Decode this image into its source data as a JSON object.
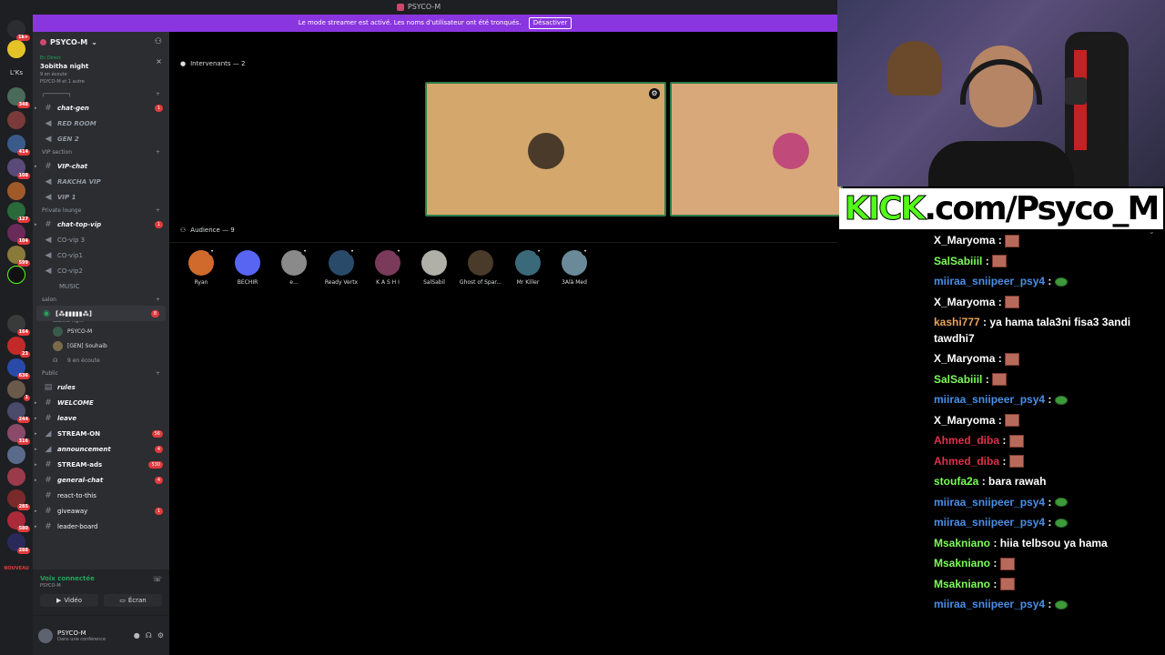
{
  "window": {
    "title": "PSYCO-M"
  },
  "banner": {
    "text": "Le mode streamer est activé. Les noms d'utilisateur ont été tronqués.",
    "button": "Désactiver"
  },
  "rail": {
    "label_lks": "L'Ks",
    "badges": [
      "1k+",
      "348",
      "414",
      "108",
      "127",
      "104",
      "599",
      "164",
      "23",
      "636",
      "1",
      "244",
      "316",
      "285",
      "580",
      "288",
      "NOUVEAU"
    ]
  },
  "server": {
    "name": "PSYCO-M",
    "live_tag": "En Direct",
    "live_title": "3obitha night",
    "live_meta": "9 en écoute",
    "live_meta2": "PSYCO-M et 1 autre"
  },
  "categories": {
    "vip": "VIP section",
    "private": "Private lounge",
    "salon": "salon",
    "public": "Public"
  },
  "channels": {
    "chat_gen": "chat-gen",
    "chat_gen_badge": "1",
    "red_room": "RED ROOM",
    "gen2": "GEN 2",
    "vip_chat": "VIP-chat",
    "rakcha_vip": "RAKCHA VIP",
    "vip1": "VIP 1",
    "chat_top_vip": "chat-top-vip",
    "chat_top_vip_badge": "1",
    "co_vip3": "CO-vip 3",
    "co_vip1": "CO-vip1",
    "co_vip2": "CO-vip2",
    "music": "MUSIC",
    "stage_sub": "3obitha night",
    "stage_badge": "8",
    "stage_user1": "PSYCO-M",
    "stage_user2": "[GEN] Souhaib",
    "stage_listening": "9 en écoute",
    "rules": "rules",
    "welcome": "WELCOME",
    "leave": "leave",
    "stream_on": "STREAM-ON",
    "stream_on_badge": "56",
    "announcement": "announcement",
    "announcement_badge": "4",
    "stream_ads": "STREAM-ads",
    "stream_ads_badge": "530",
    "general_chat": "general-chat",
    "general_chat_badge": "4",
    "react": "react-to-this",
    "giveaway": "giveaway",
    "giveaway_badge": "1",
    "leaderboard": "leader-board"
  },
  "voice": {
    "connected": "Voix connectée",
    "sub": "PSYCO-M",
    "video": "Vidéo",
    "screen": "Écran"
  },
  "user": {
    "name": "PSYCO-M",
    "status": "Dans une conférence"
  },
  "stage": {
    "speakers_label": "Intervenants — 2",
    "audience_label": "Audience — 9",
    "audience": [
      {
        "name": "Ryan",
        "color": "#d06a2c"
      },
      {
        "name": "BECHIR",
        "color": "#5865f2"
      },
      {
        "name": "e...",
        "color": "#8a8a8a"
      },
      {
        "name": "Ready Vertx",
        "color": "#2a4a6a"
      },
      {
        "name": "K A S H I",
        "color": "#7a3a5a"
      },
      {
        "name": "SalSabil",
        "color": "#b0b0a8"
      },
      {
        "name": "Ghost of Spar...",
        "color": "#4a3a2a"
      },
      {
        "name": "Mr Killer",
        "color": "#3a6a7a"
      },
      {
        "name": "3Alà Med",
        "color": "#6a8a9a"
      }
    ]
  },
  "overlay": {
    "kick_prefix": "KICK",
    "kick_rest": ".com/Psyco_M"
  },
  "chat": [
    {
      "user": "X_Maryoma",
      "color": "#ffffff",
      "text": "",
      "emote": "em"
    },
    {
      "user": "SalSabiiil",
      "color": "#7cfc5a",
      "text": "",
      "emote": "em"
    },
    {
      "user": "miiraa_sniipeer_psy4",
      "color": "#4a8fe8",
      "text": "",
      "emote": "pepe"
    },
    {
      "user": "X_Maryoma",
      "color": "#ffffff",
      "text": "",
      "emote": "em"
    },
    {
      "user": "kashi777",
      "color": "#e8a45a",
      "text": "ya hama tala3ni fisa3 3andi tawdhi7",
      "emote": ""
    },
    {
      "user": "X_Maryoma",
      "color": "#ffffff",
      "text": "",
      "emote": "em"
    },
    {
      "user": "SalSabiiil",
      "color": "#7cfc5a",
      "text": "",
      "emote": "em"
    },
    {
      "user": "miiraa_sniipeer_psy4",
      "color": "#4a8fe8",
      "text": "",
      "emote": "pepe"
    },
    {
      "user": "X_Maryoma",
      "color": "#ffffff",
      "text": "",
      "emote": "em"
    },
    {
      "user": "Ahmed_diba",
      "color": "#e0304a",
      "text": "",
      "emote": "em"
    },
    {
      "user": "Ahmed_diba",
      "color": "#e0304a",
      "text": "",
      "emote": "em"
    },
    {
      "user": "stoufa2a",
      "color": "#7cfc5a",
      "text": "bara rawah",
      "emote": ""
    },
    {
      "user": "miiraa_sniipeer_psy4",
      "color": "#4a8fe8",
      "text": "",
      "emote": "pepe"
    },
    {
      "user": "miiraa_sniipeer_psy4",
      "color": "#4a8fe8",
      "text": "",
      "emote": "pepe"
    },
    {
      "user": "Msakniano",
      "color": "#7cfc5a",
      "text": "hiia telbsou ya hama",
      "emote": ""
    },
    {
      "user": "Msakniano",
      "color": "#7cfc5a",
      "text": "",
      "emote": "em"
    },
    {
      "user": "Msakniano",
      "color": "#7cfc5a",
      "text": "",
      "emote": "em"
    },
    {
      "user": "miiraa_sniipeer_psy4",
      "color": "#4a8fe8",
      "text": "",
      "emote": "pepe"
    }
  ]
}
